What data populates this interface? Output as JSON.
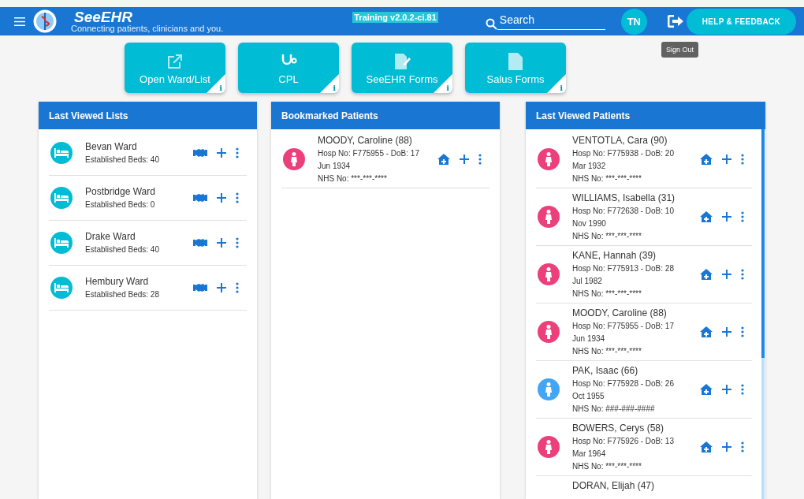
{
  "header": {
    "brand": "SeeEHR",
    "tagline": "Connecting patients, clinicians and you.",
    "version_badge": "Training v2.0.2-ci.81",
    "search": {
      "placeholder": "Search"
    },
    "avatar": "TN",
    "help_button": "HELP & FEEDBACK",
    "tooltip": "Sign Out"
  },
  "tiles": [
    {
      "kind": "open",
      "label": "Open Ward/List",
      "info": "i"
    },
    {
      "kind": "cpl",
      "label": "CPL",
      "info": "i"
    },
    {
      "kind": "forms",
      "label": "SeeEHR Forms",
      "info": "i"
    },
    {
      "kind": "doc",
      "label": "Salus Forms",
      "info": "i"
    }
  ],
  "last_viewed_lists": {
    "title": "Last Viewed Lists",
    "items": [
      {
        "name": "Bevan Ward",
        "beds": "Established Beds: 40"
      },
      {
        "name": "Postbridge Ward",
        "beds": "Established Beds: 0"
      },
      {
        "name": "Drake Ward",
        "beds": "Established Beds: 40"
      },
      {
        "name": "Hembury Ward",
        "beds": "Established Beds: 28"
      }
    ]
  },
  "bookmarked_patients": {
    "title": "Bookmarked Patients",
    "items": [
      {
        "name": "MOODY, Caroline (88)",
        "details": "Hosp No: F775955 - DoB: 17 Jun 1934",
        "nhs": "NHS No: ***-***-****",
        "color": "#ec407a"
      }
    ]
  },
  "last_viewed_patients": {
    "title": "Last Viewed Patients",
    "items": [
      {
        "name": "VENTOTLA, Cara (90)",
        "details": "Hosp No: F775938 - DoB: 20 Mar 1932",
        "nhs": "NHS No: ***-***-****",
        "color": "#ec407a"
      },
      {
        "name": "WILLIAMS, Isabella (31)",
        "details": "Hosp No: F772638 - DoB: 10 Nov 1990",
        "nhs": "NHS No: ***-***-****",
        "color": "#ec407a"
      },
      {
        "name": "KANE, Hannah (39)",
        "details": "Hosp No: F775913 - DoB: 28 Jul 1982",
        "nhs": "NHS No: ***-***-****",
        "color": "#ec407a"
      },
      {
        "name": "MOODY, Caroline (88)",
        "details": "Hosp No: F775955 - DoB: 17 Jun 1934",
        "nhs": "NHS No: ***-***-****",
        "color": "#ec407a"
      },
      {
        "name": "PAK, Isaac (66)",
        "details": "Hosp No: F775928 - DoB: 26 Oct 1955",
        "nhs": "NHS No: ###-###-####",
        "color": "#42a5f5"
      },
      {
        "name": "BOWERS, Cerys (58)",
        "details": "Hosp No: F775926 - DoB: 13 Mar 1964",
        "nhs": "NHS No: ***-***-****",
        "color": "#ec407a"
      },
      {
        "name": "DORAN, Elijah (47)"
      }
    ]
  }
}
